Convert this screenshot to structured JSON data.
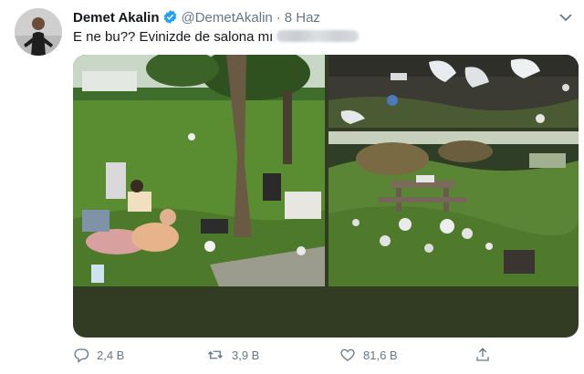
{
  "tweet": {
    "display_name": "Demet Akalin",
    "handle": "@DemetAkalin",
    "separator": "·",
    "time": "8 Haz",
    "text": "E ne bu?? Evinizde de salona mı",
    "verified": true
  },
  "media": {
    "photos": [
      {
        "name": "park-picnic-photo",
        "description": ""
      },
      {
        "name": "litter-on-grass-photo",
        "description": ""
      },
      {
        "name": "littered-picnic-table-photo",
        "description": ""
      }
    ]
  },
  "actions": {
    "reply_count": "2,4 B",
    "retweet_count": "3,9 B",
    "like_count": "81,6 B"
  },
  "colors": {
    "secondary_text": "#657786",
    "verified_blue": "#1da1f2",
    "media_bottom": "#323c22"
  },
  "icons": [
    "verified-badge-icon",
    "more-icon",
    "reply-icon",
    "retweet-icon",
    "like-icon",
    "share-icon"
  ]
}
